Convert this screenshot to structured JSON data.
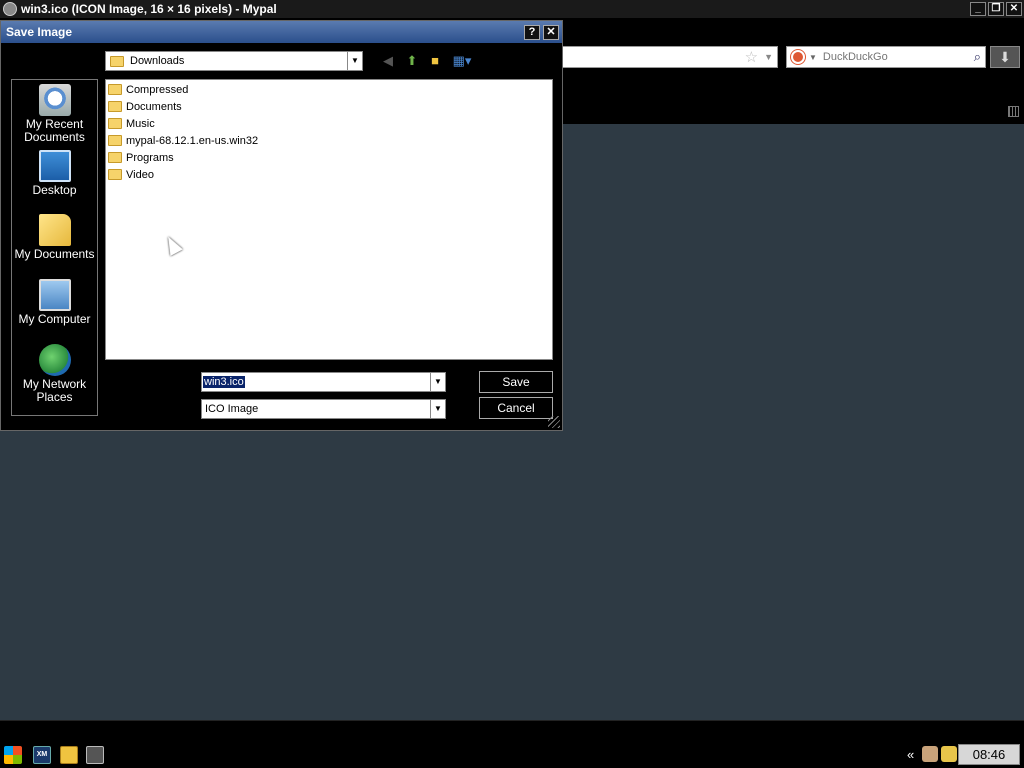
{
  "browser": {
    "window_title": "win3.ico (ICON Image, 16 × 16 pixels) - Mypal",
    "controls": {
      "minimize": "_",
      "maximize": "❐",
      "close": "✕"
    },
    "search": {
      "engine": "DuckDuckGo",
      "placeholder": "DuckDuckGo"
    }
  },
  "dialog": {
    "title": "Save Image",
    "controls": {
      "help": "?",
      "close": "✕"
    },
    "look_in": "Downloads",
    "places": [
      {
        "label": "My Recent Documents",
        "icon": "recent-documents-icon"
      },
      {
        "label": "Desktop",
        "icon": "desktop-icon"
      },
      {
        "label": "My Documents",
        "icon": "my-documents-icon"
      },
      {
        "label": "My Computer",
        "icon": "my-computer-icon"
      },
      {
        "label": "My Network Places",
        "icon": "network-places-icon"
      }
    ],
    "files": [
      {
        "name": "Compressed",
        "type": "folder"
      },
      {
        "name": "Documents",
        "type": "folder"
      },
      {
        "name": "Music",
        "type": "folder"
      },
      {
        "name": "mypal-68.12.1.en-us.win32",
        "type": "folder"
      },
      {
        "name": "Programs",
        "type": "folder"
      },
      {
        "name": "Video",
        "type": "folder"
      }
    ],
    "file_name": "win3.ico",
    "save_as_type": "ICO Image",
    "buttons": {
      "save": "Save",
      "cancel": "Cancel"
    }
  },
  "taskbar": {
    "clock": "08:46",
    "tray_chevron": "«",
    "xm_label": "XM"
  },
  "colors": {
    "desktop": "#2e3a44",
    "dialog_title_gradient": [
      "#5a7bb0",
      "#2b4f8c"
    ],
    "selection": "#0a246a"
  }
}
